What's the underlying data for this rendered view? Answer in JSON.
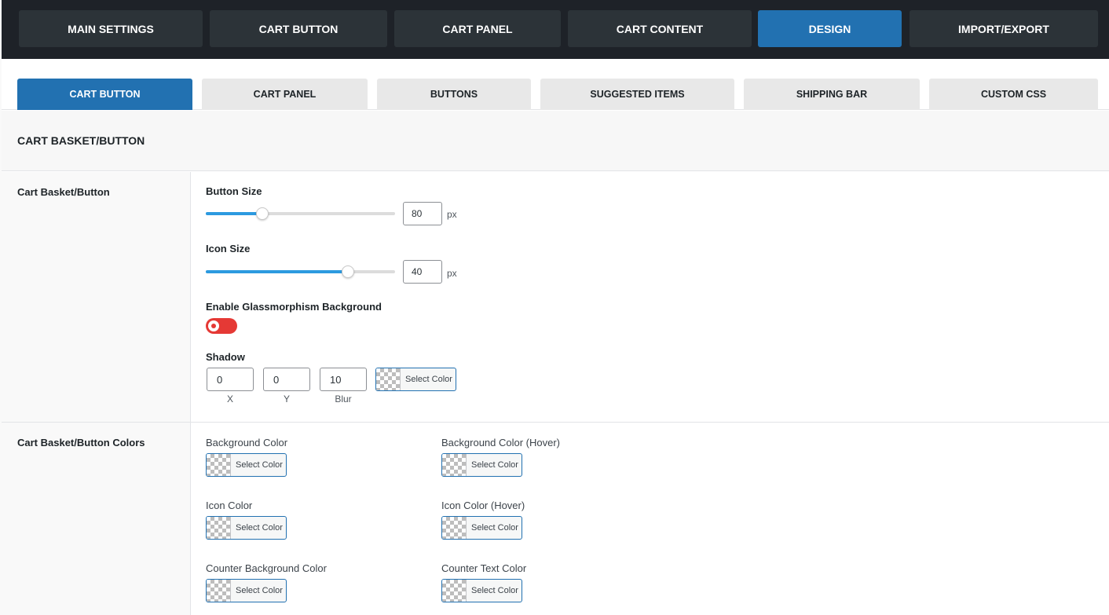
{
  "top_nav": {
    "items": [
      {
        "label": "MAIN SETTINGS"
      },
      {
        "label": "CART BUTTON"
      },
      {
        "label": "CART PANEL"
      },
      {
        "label": "CART CONTENT"
      },
      {
        "label": "DESIGN",
        "active": true
      },
      {
        "label": "IMPORT/EXPORT"
      }
    ]
  },
  "sub_nav": {
    "items": [
      {
        "label": "CART BUTTON",
        "active": true
      },
      {
        "label": "CART PANEL"
      },
      {
        "label": "BUTTONS"
      },
      {
        "label": "SUGGESTED ITEMS"
      },
      {
        "label": "SHIPPING BAR"
      },
      {
        "label": "CUSTOM CSS"
      }
    ]
  },
  "section": {
    "title": "CART BASKET/BUTTON"
  },
  "basket_row": {
    "label": "Cart Basket/Button",
    "button_size": {
      "label": "Button Size",
      "value": "80",
      "unit": "px",
      "slider_fraction": 0.3
    },
    "icon_size": {
      "label": "Icon Size",
      "value": "40",
      "unit": "px",
      "slider_fraction": 0.75
    },
    "glass": {
      "label": "Enable Glassmorphism Background",
      "enabled": false
    },
    "shadow": {
      "label": "Shadow",
      "x": "0",
      "x_caption": "X",
      "y": "0",
      "y_caption": "Y",
      "blur": "10",
      "blur_caption": "Blur",
      "color_button": "Select Color"
    }
  },
  "colors_row": {
    "label": "Cart Basket/Button Colors",
    "fields": [
      {
        "label": "Background Color",
        "button": "Select Color"
      },
      {
        "label": "Background Color (Hover)",
        "button": "Select Color"
      },
      {
        "label": "Icon Color",
        "button": "Select Color"
      },
      {
        "label": "Icon Color (Hover)",
        "button": "Select Color"
      },
      {
        "label": "Counter Background Color",
        "button": "Select Color"
      },
      {
        "label": "Counter Text Color",
        "button": "Select Color"
      }
    ]
  },
  "colors": {
    "accent": "#2271b1",
    "topbar": "#1e2228",
    "slider_fill": "#2c9ae0",
    "toggle_off": "#e53935"
  }
}
